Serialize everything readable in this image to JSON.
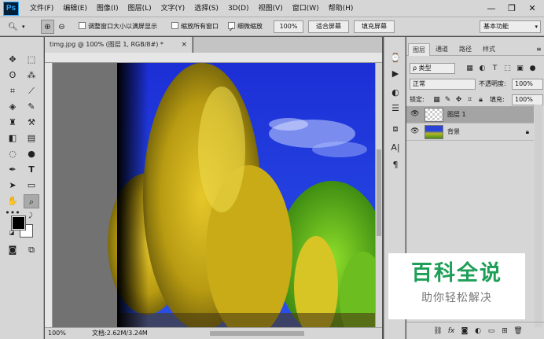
{
  "app": {
    "logo": "Ps"
  },
  "menu": [
    "文件(F)",
    "编辑(E)",
    "图像(I)",
    "图层(L)",
    "文字(Y)",
    "选择(S)",
    "3D(D)",
    "视图(V)",
    "窗口(W)",
    "帮助(H)"
  ],
  "window_controls": {
    "minimize": "—",
    "restore": "❐",
    "close": "✕"
  },
  "options": {
    "resize_windows": "调整窗口大小以满屏显示",
    "zoom_all": "缩放所有窗口",
    "scrubby_zoom": "细微缩放",
    "zoom_value": "100%",
    "fit_screen": "适合屏幕",
    "fill_screen": "填充屏幕",
    "workspace": "基本功能"
  },
  "document": {
    "tab_title": "timg.jpg @ 100% (图层 1, RGB/8#) *",
    "zoom": "100%",
    "doc_info": "文档:2.62M/3.24M"
  },
  "layers_panel": {
    "tabs": [
      "图层",
      "通道",
      "路径",
      "样式"
    ],
    "kind": "ρ 类型",
    "blend_mode": "正常",
    "opacity_label": "不透明度:",
    "opacity": "100%",
    "lock_label": "锁定:",
    "fill_label": "填充:",
    "fill": "100%",
    "layers": [
      {
        "name": "图层 1",
        "selected": true,
        "locked": false
      },
      {
        "name": "背景",
        "selected": false,
        "locked": true
      }
    ],
    "bottom_icons": [
      "link-icon",
      "fx-icon",
      "mask-icon",
      "adjustment-icon",
      "folder-icon",
      "new-layer-icon",
      "trash-icon"
    ]
  },
  "watermark": {
    "main": "百科全说",
    "sub": "助你轻松解决"
  }
}
